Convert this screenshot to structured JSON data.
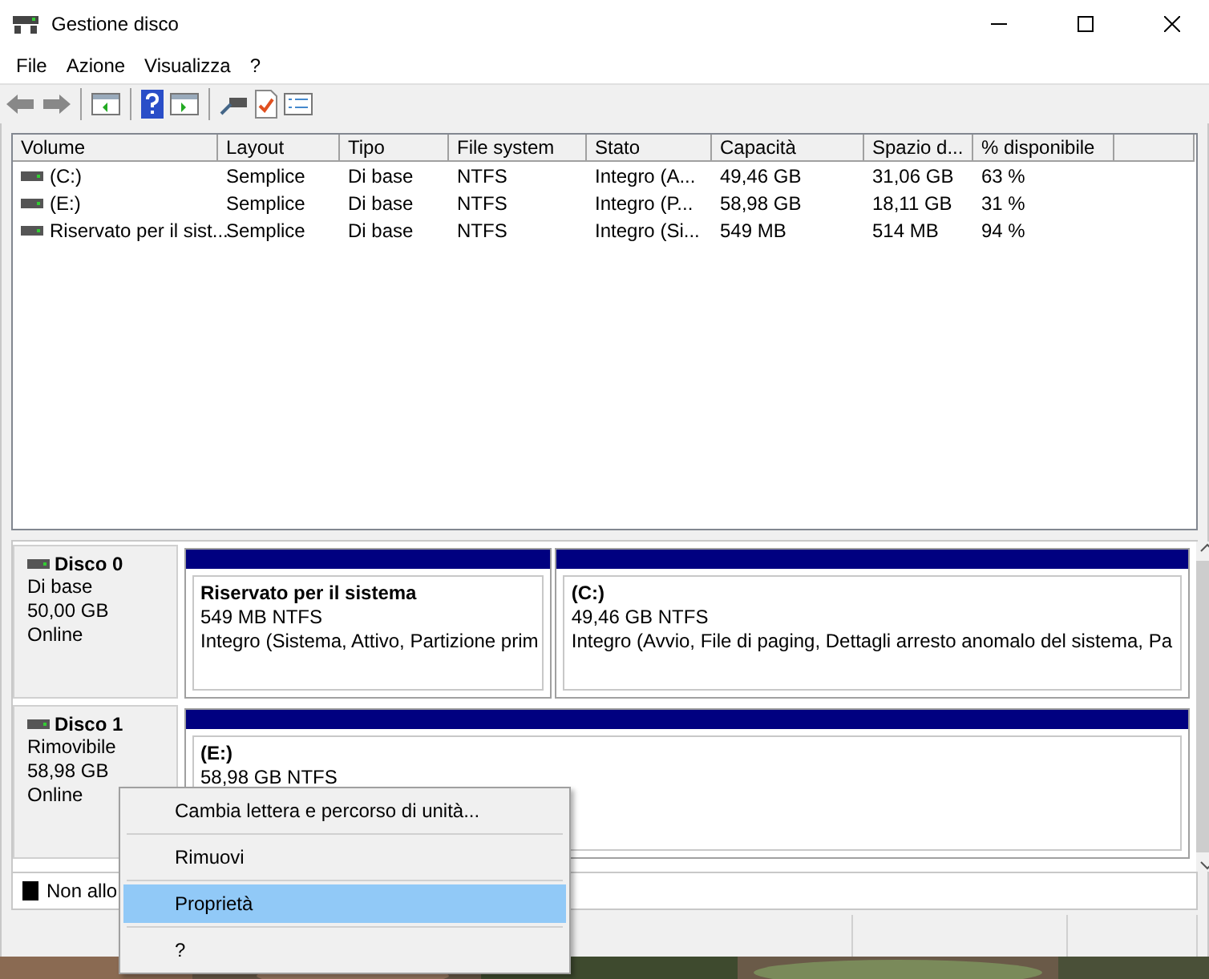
{
  "window": {
    "title": "Gestione disco"
  },
  "menu": [
    "File",
    "Azione",
    "Visualizza",
    "?"
  ],
  "table": {
    "columns": [
      "Volume",
      "Layout",
      "Tipo",
      "File system",
      "Stato",
      "Capacità",
      "Spazio d...",
      "% disponibile"
    ],
    "rows": [
      {
        "cells": [
          "(C:)",
          "Semplice",
          "Di base",
          "NTFS",
          "Integro (A...",
          "49,46 GB",
          "31,06 GB",
          "63 %"
        ]
      },
      {
        "cells": [
          "(E:)",
          "Semplice",
          "Di base",
          "NTFS",
          "Integro (P...",
          "58,98 GB",
          "18,11 GB",
          "31 %"
        ]
      },
      {
        "cells": [
          "Riservato per il sist...",
          "Semplice",
          "Di base",
          "NTFS",
          "Integro (Si...",
          "549 MB",
          "514 MB",
          "94 %"
        ]
      }
    ]
  },
  "disks": [
    {
      "name": "Disco 0",
      "type": "Di base",
      "size": "50,00 GB",
      "status": "Online",
      "partitions": [
        {
          "title": "Riservato per il sistema",
          "detail": "549 MB NTFS",
          "status": "Integro (Sistema, Attivo, Partizione prim"
        },
        {
          "title": "(C:)",
          "detail": "49,46 GB NTFS",
          "status": "Integro (Avvio, File di paging, Dettagli arresto anomalo del sistema, Pa"
        }
      ]
    },
    {
      "name": "Disco 1",
      "type": "Rimovibile",
      "size": "58,98 GB",
      "status": "Online",
      "partitions": [
        {
          "title": "(E:)",
          "detail": "58,98 GB NTFS"
        }
      ]
    }
  ],
  "legend": "Non allo",
  "context_menu": [
    {
      "label": "Cambia lettera e percorso di unità...",
      "selected": false
    },
    {
      "label": "Rimuovi",
      "selected": false
    },
    {
      "label": "Proprietà",
      "selected": true
    },
    {
      "label": "?",
      "selected": false
    }
  ]
}
